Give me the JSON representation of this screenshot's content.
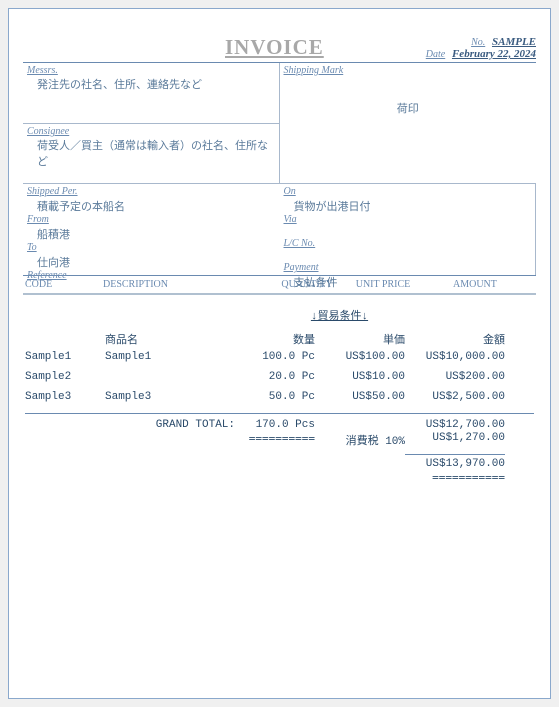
{
  "header": {
    "title": "INVOICE",
    "no_label": "No.",
    "no_value": "SAMPLE",
    "date_label": "Date",
    "date_value": "February 22, 2024"
  },
  "fields": {
    "messrs_label": "Messrs.",
    "messrs_value": "発注先の社名、住所、連絡先など",
    "shipmark_label": "Shipping Mark",
    "shipmark_value": "荷印",
    "consignee_label": "Consignee",
    "consignee_value": "荷受人／買主（通常は輸入者）の社名、住所など",
    "shippedper_label": "Shipped Per.",
    "shippedper_value": "積載予定の本船名",
    "from_label": "From",
    "from_value": "船積港",
    "to_label": "To",
    "to_value": "仕向港",
    "reference_label": "Reference",
    "on_label": "On",
    "on_value": "貨物が出港日付",
    "via_label": "Via",
    "lcno_label": "L/C No.",
    "payment_label": "Payment",
    "payment_value": "支払条件"
  },
  "columns": {
    "code": "CODE",
    "desc": "DESCRIPTION",
    "qty": "QUANTITY",
    "unit": "UNIT PRICE",
    "amount": "AMOUNT"
  },
  "trade_terms": "↓貿易条件↓",
  "jheaders": {
    "name": "商品名",
    "qty": "数量",
    "unit": "単価",
    "amount": "金額"
  },
  "items": [
    {
      "code": "Sample1",
      "desc": "Sample1",
      "qty": "100.0 Pc",
      "unit": "US$100.00",
      "amount": "US$10,000.00"
    },
    {
      "code": "Sample2",
      "desc": "",
      "qty": "20.0 Pc",
      "unit": "US$10.00",
      "amount": "US$200.00"
    },
    {
      "code": "Sample3",
      "desc": "Sample3",
      "qty": "50.0 Pc",
      "unit": "US$50.00",
      "amount": "US$2,500.00"
    }
  ],
  "totals": {
    "grand_label": "GRAND TOTAL:",
    "grand_qty": "170.0 Pcs",
    "subtotal": "US$12,700.00",
    "tax_label": "消費税 10%",
    "tax_amount": "US$1,270.00",
    "final": "US$13,970.00",
    "dashes": "==========",
    "dashes2": "==========="
  }
}
